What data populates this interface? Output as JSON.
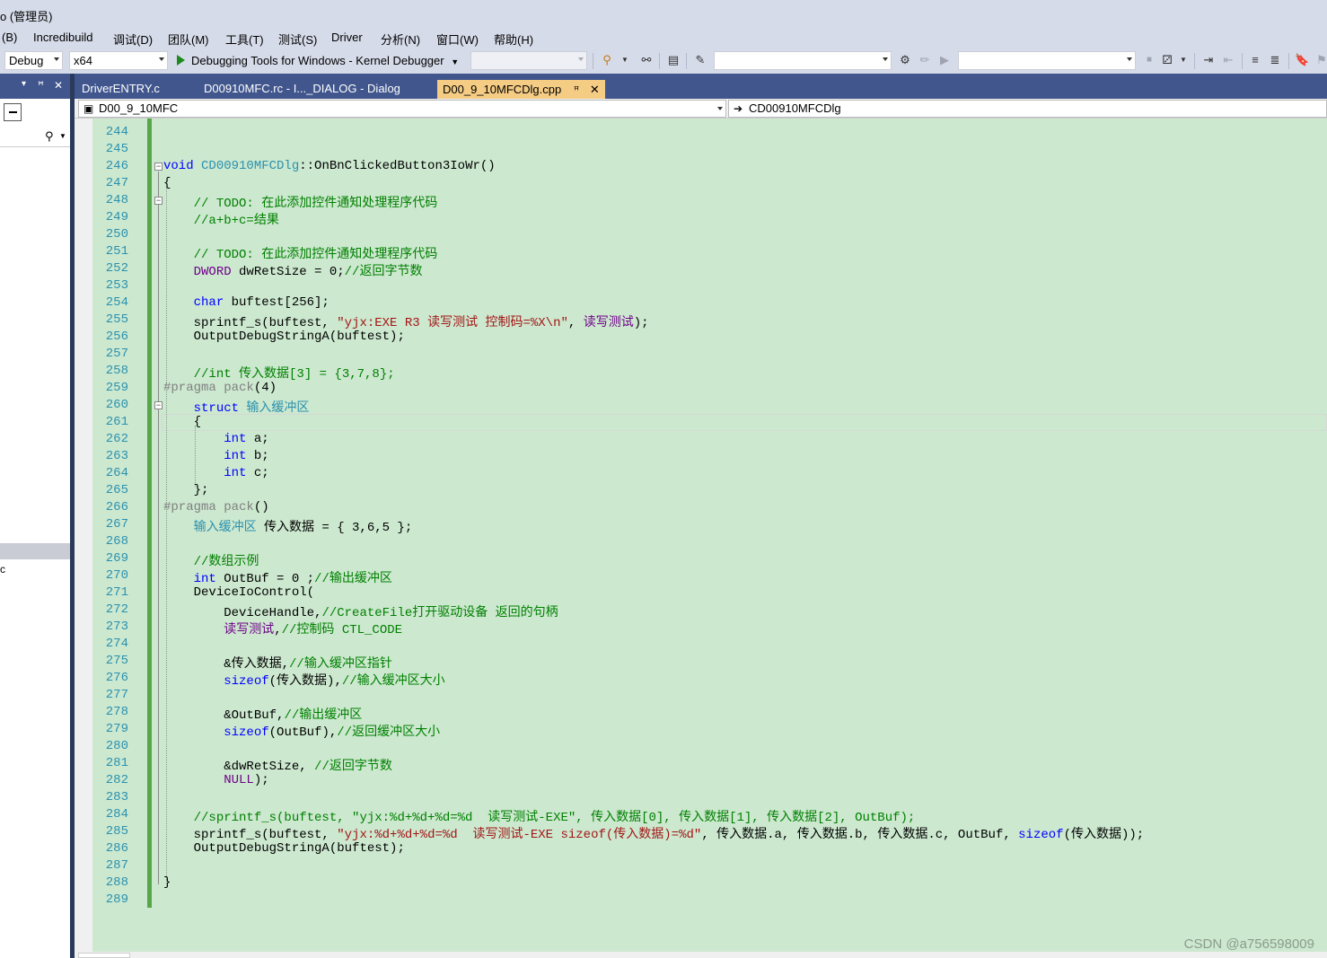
{
  "window": {
    "title": "o (管理员)"
  },
  "menu": [
    "(B)",
    "Incredibuild",
    "调试(D)",
    "团队(M)",
    "工具(T)",
    "测试(S)",
    "Driver",
    "分析(N)",
    "窗口(W)",
    "帮助(H)"
  ],
  "toolbar": {
    "config": "Debug",
    "platform": "x64",
    "debugger": "Debugging Tools for Windows - Kernel Debugger"
  },
  "tabs": [
    {
      "label": "DriverENTRY.c",
      "active": false
    },
    {
      "label": "D00910MFC.rc - I..._DIALOG - Dialog",
      "active": false
    },
    {
      "label": "D00_9_10MFCDlg.cpp",
      "active": true,
      "pin": "ꟸ",
      "close": "✕"
    }
  ],
  "nav": {
    "project": "D00_9_10MFC",
    "class": "CD00910MFCDlg"
  },
  "left_panel": {
    "pin": "ꟸ",
    "close": "✕",
    "dropdown": "▾",
    "cut_text": "c"
  },
  "editor": {
    "line_numbers": [
      "244",
      "245",
      "246",
      "247",
      "248",
      "249",
      "250",
      "251",
      "252",
      "253",
      "254",
      "255",
      "256",
      "257",
      "258",
      "259",
      "260",
      "261",
      "262",
      "263",
      "264",
      "265",
      "266",
      "267",
      "268",
      "269",
      "270",
      "271",
      "272",
      "273",
      "274",
      "275",
      "276",
      "277",
      "278",
      "279",
      "280",
      "281",
      "282",
      "283",
      "284",
      "285",
      "286",
      "287",
      "288",
      "289"
    ],
    "code": {
      "l246_kw": "void",
      "l246_cls": "CD00910MFCDlg",
      "l246_rest": "::OnBnClickedButton3IoWr()",
      "l247": "{",
      "l248": "// TODO: 在此添加控件通知处理程序代码",
      "l249": "//a+b+c=结果",
      "l251": "// TODO: 在此添加控件通知处理程序代码",
      "l252_ty": "DWORD",
      "l252_rest": " dwRetSize = 0;",
      "l252_cm": "//返回字节数",
      "l254_kw": "char",
      "l254_rest": " buftest[256];",
      "l255_a": "sprintf_s(buftest, ",
      "l255_st": "\"yjx:EXE R3 读写测试 控制码=%X\\n\"",
      "l255_b": ", ",
      "l255_mc": "读写测试",
      "l255_c": ");",
      "l256": "OutputDebugStringA(buftest);",
      "l258": "//int 传入数据[3] = {3,7,8};",
      "l259_pp": "#pragma pack",
      "l259_rest": "(4)",
      "l260_kw": "struct",
      "l260_ty": " 输入缓冲区",
      "l261": "{",
      "l262_kw": "int",
      "l262_rest": " a;",
      "l263_kw": "int",
      "l263_rest": " b;",
      "l264_kw": "int",
      "l264_rest": " c;",
      "l265": "};",
      "l266_pp": "#pragma pack",
      "l266_rest": "()",
      "l267_ty": "输入缓冲区",
      "l267_rest": " 传入数据 = { 3,6,5 };",
      "l269": "//数组示例",
      "l270_kw": "int",
      "l270_rest": " OutBuf = 0 ;",
      "l270_cm": "//输出缓冲区",
      "l271": "DeviceIoControl(",
      "l272_a": "DeviceHandle,",
      "l272_cm": "//CreateFile打开驱动设备 返回的句柄",
      "l273_mc": "读写测试",
      "l273_a": ",",
      "l273_cm": "//控制码 CTL_CODE",
      "l275_a": "&传入数据,",
      "l275_cm": "//输入缓冲区指针",
      "l276_kw": "sizeof",
      "l276_a": "(传入数据),",
      "l276_cm": "//输入缓冲区大小",
      "l278_a": "&OutBuf,",
      "l278_cm": "//输出缓冲区",
      "l279_kw": "sizeof",
      "l279_a": "(OutBuf),",
      "l279_cm": "//返回缓冲区大小",
      "l281_a": "&dwRetSize, ",
      "l281_cm": "//返回字节数",
      "l282_mc": "NULL",
      "l282_a": ");",
      "l284": "//sprintf_s(buftest, \"yjx:%d+%d+%d=%d  读写测试-EXE\", 传入数据[0], 传入数据[1], 传入数据[2], OutBuf);",
      "l285_a": "sprintf_s(buftest, ",
      "l285_st": "\"yjx:%d+%d+%d=%d  读写测试-EXE sizeof(传入数据)=%d\"",
      "l285_b": ", 传入数据.a, 传入数据.b, 传入数据.c, OutBuf, ",
      "l285_kw": "sizeof",
      "l285_c": "(传入数据));",
      "l286": "OutputDebugStringA(buftest);",
      "l288": "}"
    }
  },
  "watermark": "CSDN @a756598009",
  "colors": {
    "editor_bg": "#cce8cf",
    "tab_active": "#f5cc84",
    "tab_bar": "#40568d",
    "keyword": "#0000ff",
    "comment": "#008000",
    "string": "#a31515",
    "macro": "#6f008a",
    "type": "#2b91af"
  },
  "icons": [
    "find-in-files-icon",
    "attach-icon",
    "breakpoints-icon",
    "immediate-icon",
    "solution-icon",
    "step-icon",
    "bookmark-icon"
  ]
}
